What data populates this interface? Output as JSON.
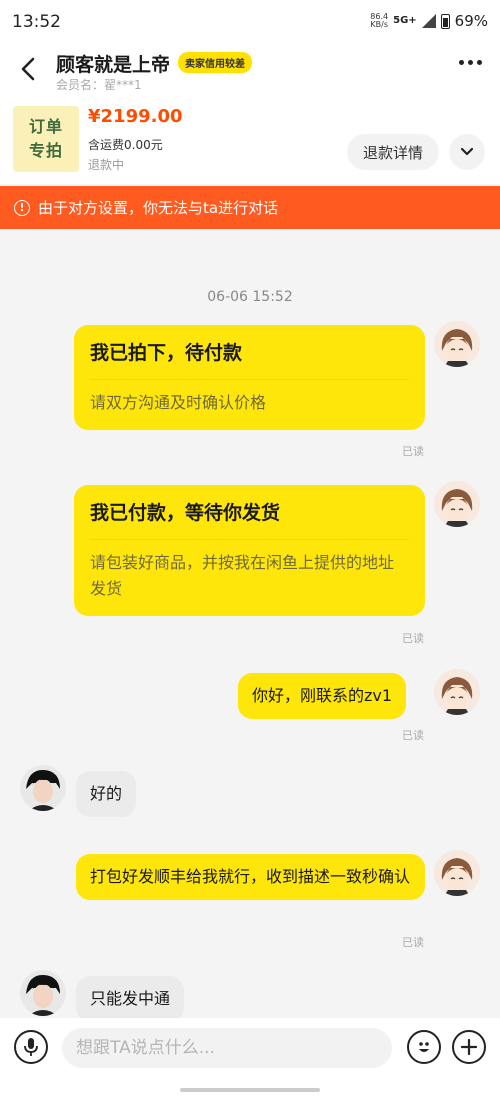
{
  "status_bar": {
    "time": "13:52",
    "net_speed_value": "86.4",
    "net_speed_unit": "KB/s",
    "network": "5G+",
    "battery": "69%"
  },
  "header": {
    "title": "顾客就是上帝",
    "badge": "卖家信用较差",
    "member": "会员名：翟***1"
  },
  "order": {
    "thumb_line1": "订单",
    "thumb_line2": "专拍",
    "price": "¥2199.00",
    "shipping": "含运费0.00元",
    "status": "退款中",
    "refund_button": "退款详情"
  },
  "notice": {
    "icon_glyph": "!",
    "text": "由于对方设置，你无法与ta进行对话"
  },
  "chat": {
    "timestamp": "06-06 15:52",
    "messages": [
      {
        "title": "我已拍下，待付款",
        "body": "请双方沟通及时确认价格",
        "read": "已读"
      },
      {
        "title": "我已付款，等待你发货",
        "body": "请包装好商品，并按我在闲鱼上提供的地址发货",
        "read": "已读"
      },
      {
        "text": "你好，刚联系的zv1",
        "read": "已读"
      },
      {
        "text": "好的"
      },
      {
        "text": "打包好发顺丰给我就行，收到描述一致秒确认",
        "read": "已读"
      },
      {
        "text": "只能发中通"
      }
    ]
  },
  "input": {
    "placeholder": "想跟TA说点什么..."
  },
  "colors": {
    "accent_yellow": "#ffe60a",
    "notice_orange": "#ff5a1f",
    "price_red": "#ff4d00"
  },
  "icons": [
    "back-arrow-icon",
    "more-icon",
    "chevron-down-icon",
    "warning-icon",
    "microphone-icon",
    "emoji-icon",
    "plus-icon"
  ]
}
